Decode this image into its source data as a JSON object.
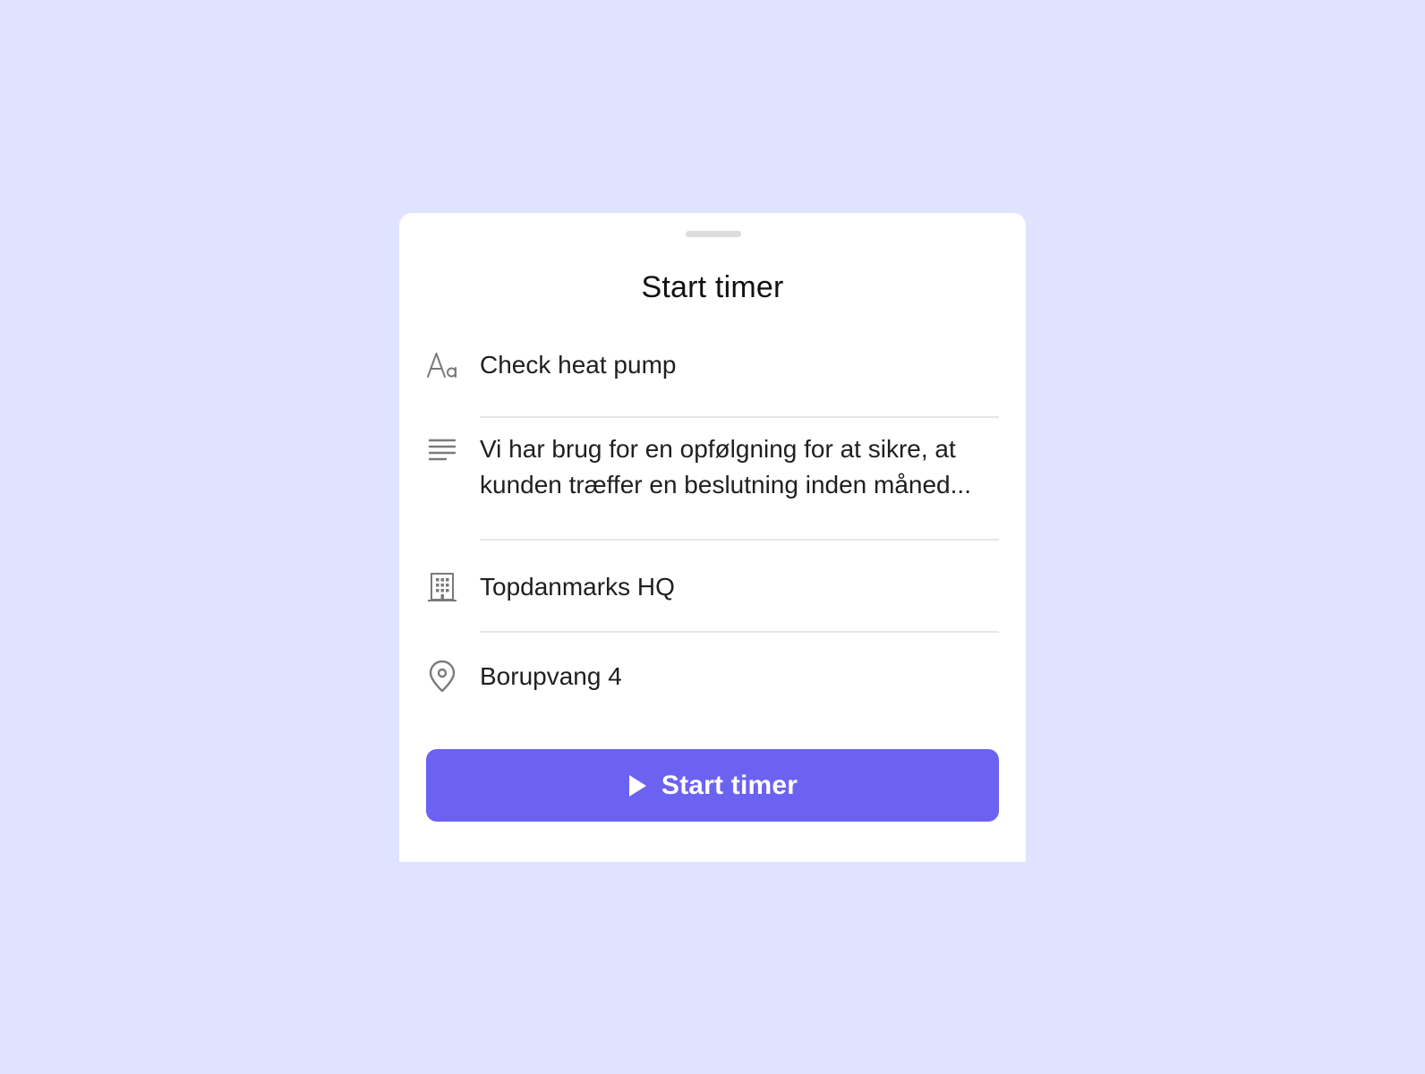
{
  "sheet": {
    "title": "Start timer"
  },
  "fields": {
    "name": {
      "icon": "text-format-icon",
      "value": "Check heat pump"
    },
    "description": {
      "icon": "align-left-icon",
      "value": "Vi har brug for en opfølgning for at sikre, at kunden træffer en beslutning inden måned..."
    },
    "company": {
      "icon": "building-icon",
      "value": "Topdanmarks HQ"
    },
    "address": {
      "icon": "location-pin-icon",
      "value": "Borupvang 4"
    }
  },
  "action": {
    "icon": "play-icon",
    "label": "Start timer"
  },
  "colors": {
    "background": "#dfe3fe",
    "accent": "#6c62f2",
    "icon": "#7a7a7a"
  }
}
